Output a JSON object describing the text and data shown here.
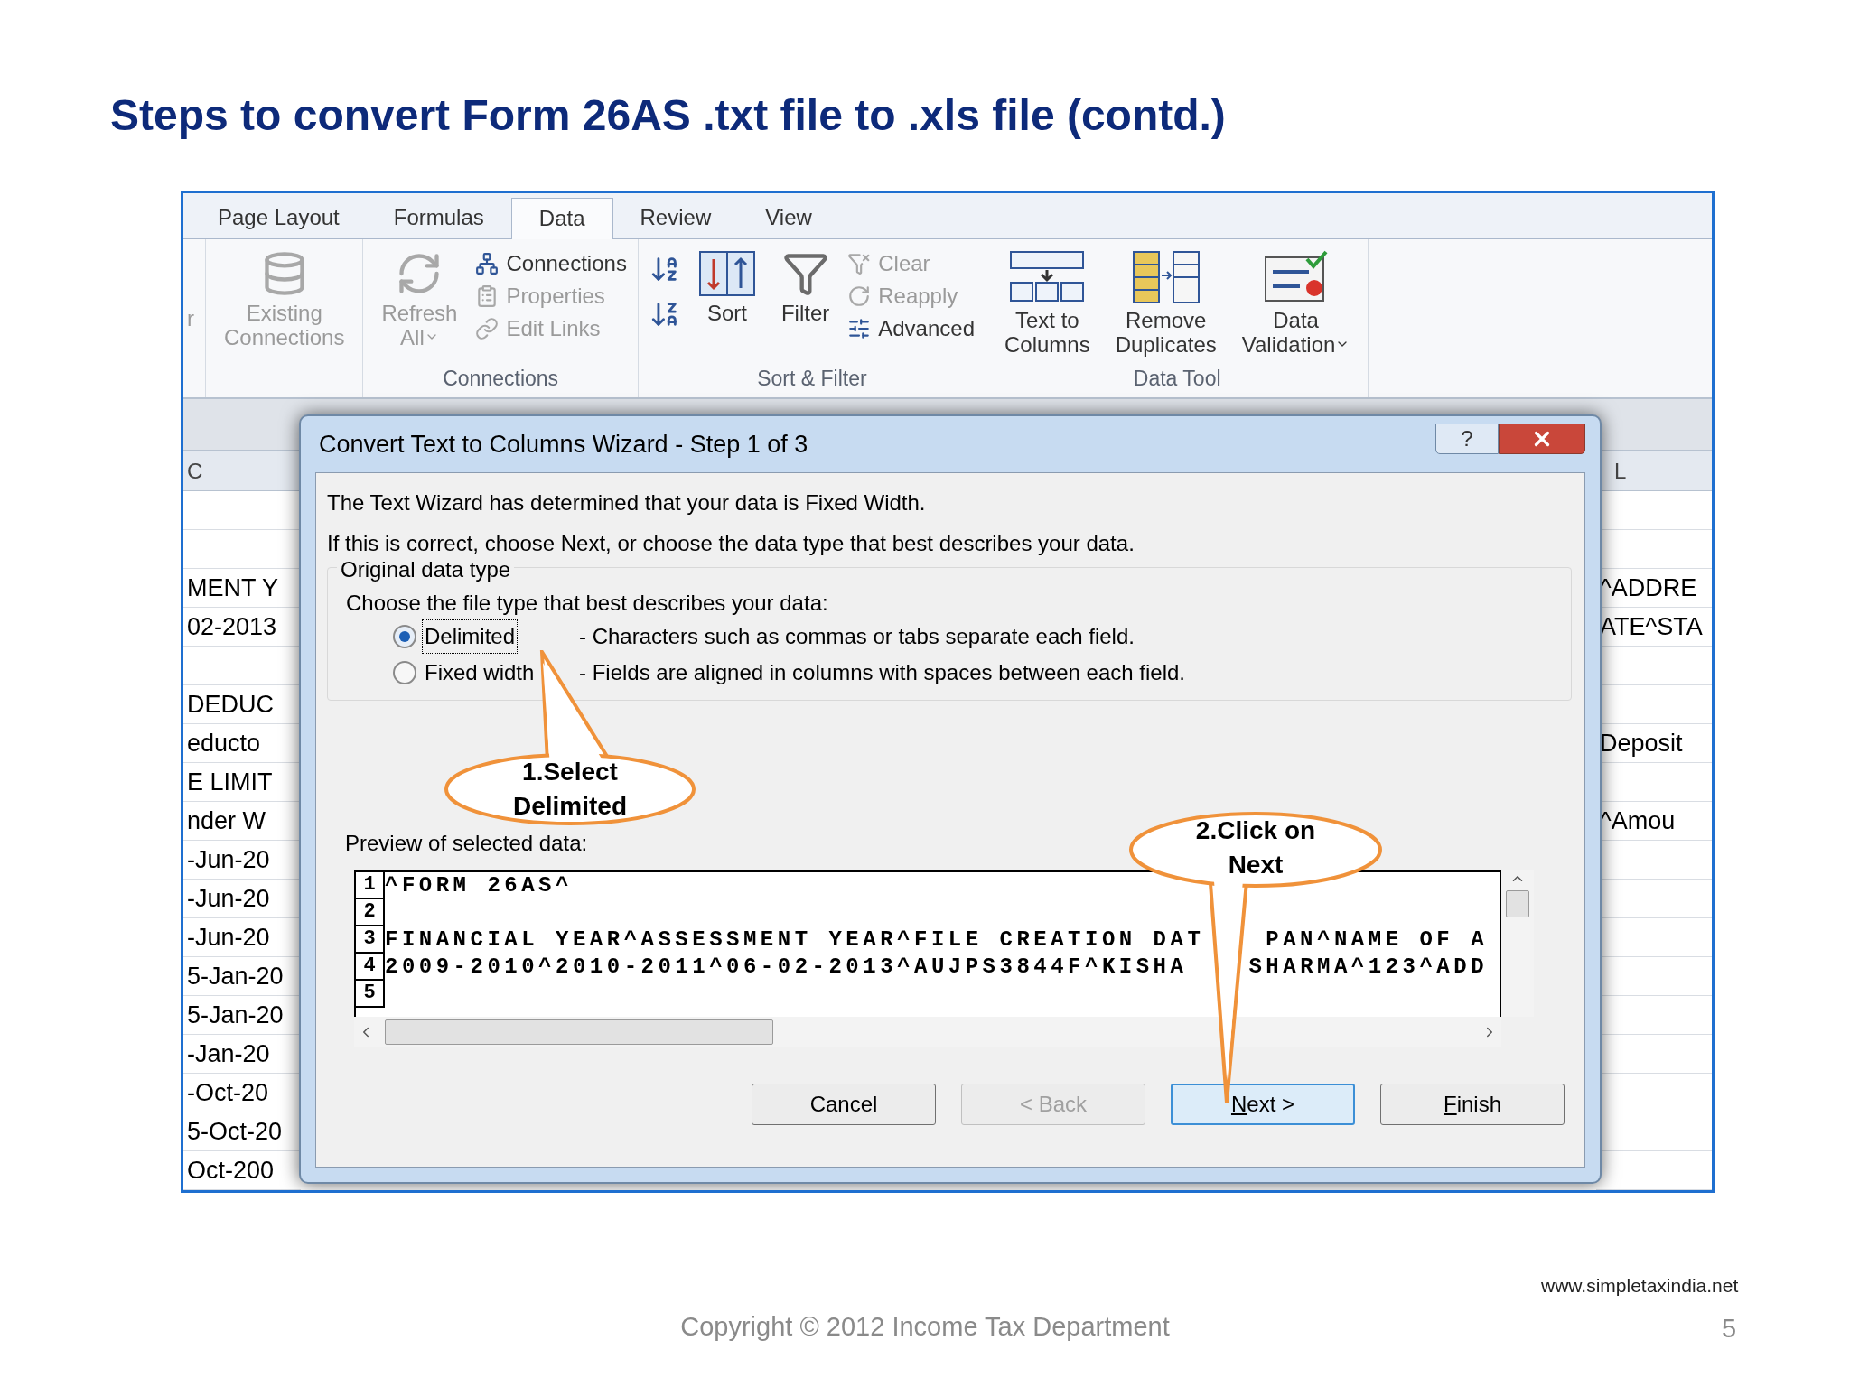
{
  "slide": {
    "title": "Steps to convert Form 26AS .txt file to .xls file (contd.)",
    "website": "www.simpletaxindia.net",
    "copyright": "Copyright © 2012 Income Tax Department",
    "page_number": "5"
  },
  "tabs": [
    {
      "label": "Page Layout",
      "selected": false
    },
    {
      "label": "Formulas",
      "selected": false
    },
    {
      "label": "Data",
      "selected": true
    },
    {
      "label": "Review",
      "selected": false
    },
    {
      "label": "View",
      "selected": false
    }
  ],
  "ribbon": {
    "leading_text": "r",
    "groups": [
      {
        "items": [
          {
            "kind": "large",
            "lines": [
              "Existing",
              "Connections"
            ],
            "disabled": true
          }
        ]
      },
      {
        "label": "Connections",
        "items": [
          {
            "kind": "large",
            "lines": [
              "Refresh",
              "All"
            ],
            "disabled": true,
            "dropdown": true
          },
          {
            "kind": "stack",
            "entries": [
              {
                "label": "Connections",
                "disabled": false
              },
              {
                "label": "Properties",
                "disabled": true
              },
              {
                "label": "Edit Links",
                "disabled": true
              }
            ]
          }
        ]
      },
      {
        "label": "Sort & Filter",
        "items": [
          {
            "kind": "icons"
          },
          {
            "kind": "large",
            "lines": [
              "Sort"
            ],
            "disabled": false
          },
          {
            "kind": "large",
            "lines": [
              "Filter"
            ],
            "disabled": false
          },
          {
            "kind": "stack",
            "entries": [
              {
                "label": "Clear",
                "disabled": true
              },
              {
                "label": "Reapply",
                "disabled": true
              },
              {
                "label": "Advanced",
                "disabled": false
              }
            ]
          }
        ]
      },
      {
        "label": "Data Tool",
        "items": [
          {
            "kind": "large",
            "lines": [
              "Text to",
              "Columns"
            ],
            "disabled": false
          },
          {
            "kind": "large",
            "lines": [
              "Remove",
              "Duplicates"
            ],
            "disabled": false
          },
          {
            "kind": "large",
            "lines": [
              "Data",
              "Validation"
            ],
            "disabled": false,
            "dropdown": true
          }
        ]
      }
    ]
  },
  "sheet": {
    "left_header": "C",
    "right_header": "L",
    "rows": [
      {},
      {},
      {
        "left": "MENT Y",
        "right": "^ADDRE"
      },
      {
        "left": "02-2013",
        "right": "ATE^STA"
      },
      {},
      {
        "left": "DEDUC"
      },
      {
        "left": "educto",
        "right": "Deposit"
      },
      {
        "left": "E LIMIT"
      },
      {
        "left": "nder W",
        "right": "^Amou"
      },
      {
        "left": "-Jun-20"
      },
      {
        "left": "-Jun-20"
      },
      {
        "left": "-Jun-20"
      },
      {
        "left": "5-Jan-20"
      },
      {
        "left": "5-Jan-20"
      },
      {
        "left": "-Jan-20"
      },
      {
        "left": "-Oct-20"
      },
      {
        "left": "5-Oct-20"
      },
      {
        "left": "Oct-200"
      }
    ]
  },
  "dialog": {
    "title": "Convert Text to Columns Wizard - Step 1 of 3",
    "help": "?",
    "intro": [
      "The Text Wizard has determined that your data is Fixed Width.",
      "If this is correct, choose Next, or choose the data type that best describes your data."
    ],
    "data_type": {
      "legend": "Original data type",
      "prompt": "Choose the file type that best describes your data:",
      "options": [
        {
          "label": "Delimited",
          "description": "- Characters such as commas or tabs separate each field.",
          "selected": true,
          "focused": true
        },
        {
          "label": "Fixed width",
          "description": "- Fields are aligned in columns with spaces between each field.",
          "selected": false,
          "focused": false
        }
      ]
    },
    "preview": {
      "label": "Preview of selected data:",
      "rows": [
        {
          "number": "1",
          "segments": [
            "^FORM 26AS^"
          ]
        },
        {
          "number": "2"
        },
        {
          "number": "3",
          "segments": [
            "FINANCIAL YEAR^ASSESSMENT YEAR^FILE CREATION DAT",
            "PAN^NAME OF A"
          ]
        },
        {
          "number": "4",
          "segments": [
            "2009-2010^2010-2011^06-02-2013^AUJPS3844F^KISHA",
            "SHARMA^123^ADD"
          ]
        },
        {
          "number": "5"
        }
      ]
    },
    "buttons": [
      {
        "label": "Cancel",
        "disabled": false,
        "default": false,
        "underline_first": false
      },
      {
        "label": "< Back",
        "disabled": true,
        "default": false,
        "underline_first": false
      },
      {
        "label": "Next >",
        "disabled": false,
        "default": true,
        "underline_first": true
      },
      {
        "label": "Finish",
        "disabled": false,
        "default": false,
        "underline_first": true
      }
    ]
  },
  "callouts": [
    {
      "text": "1.Select Delimited",
      "kind": "up"
    },
    {
      "text": "2.Click on Next",
      "kind": "down"
    }
  ]
}
